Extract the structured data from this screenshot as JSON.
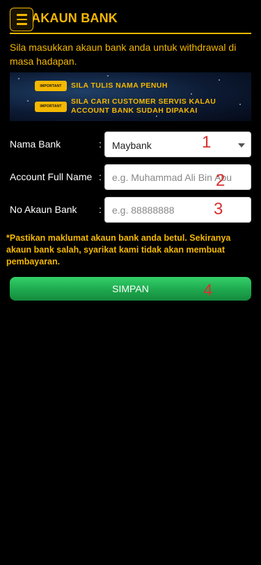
{
  "header": {
    "title": "AKAUN BANK"
  },
  "intro": "Sila masukkan akaun bank anda untuk withdrawal di masa hadapan.",
  "banner": {
    "items": [
      {
        "tag": "IMPORTANT",
        "line1": "SILA TULIS NAMA PENUH",
        "line2": ""
      },
      {
        "tag": "IMPORTANT",
        "line1": "SILA CARI CUSTOMER SERVIS KALAU",
        "line2": "ACCOUNT BANK SUDAH DIPAKAI"
      }
    ]
  },
  "form": {
    "bank_name": {
      "label": "Nama Bank",
      "colon": ":",
      "value": "Maybank",
      "marker": "1"
    },
    "full_name": {
      "label": "Account Full Name",
      "colon": ":",
      "placeholder": "e.g. Muhammad Ali Bin Abu",
      "marker": "2"
    },
    "account_no": {
      "label": "No Akaun Bank",
      "colon": ":",
      "placeholder": "e.g. 88888888",
      "marker": "3"
    }
  },
  "note": "*Pastikan maklumat akaun bank anda betul. Sekiranya akaun bank salah, syarikat kami tidak akan membuat pembayaran.",
  "save": {
    "label": "SIMPAN",
    "marker": "4"
  },
  "colors": {
    "accent": "#f5b800",
    "button": "#1ea84e",
    "marker": "#d93030",
    "background": "#000000"
  }
}
